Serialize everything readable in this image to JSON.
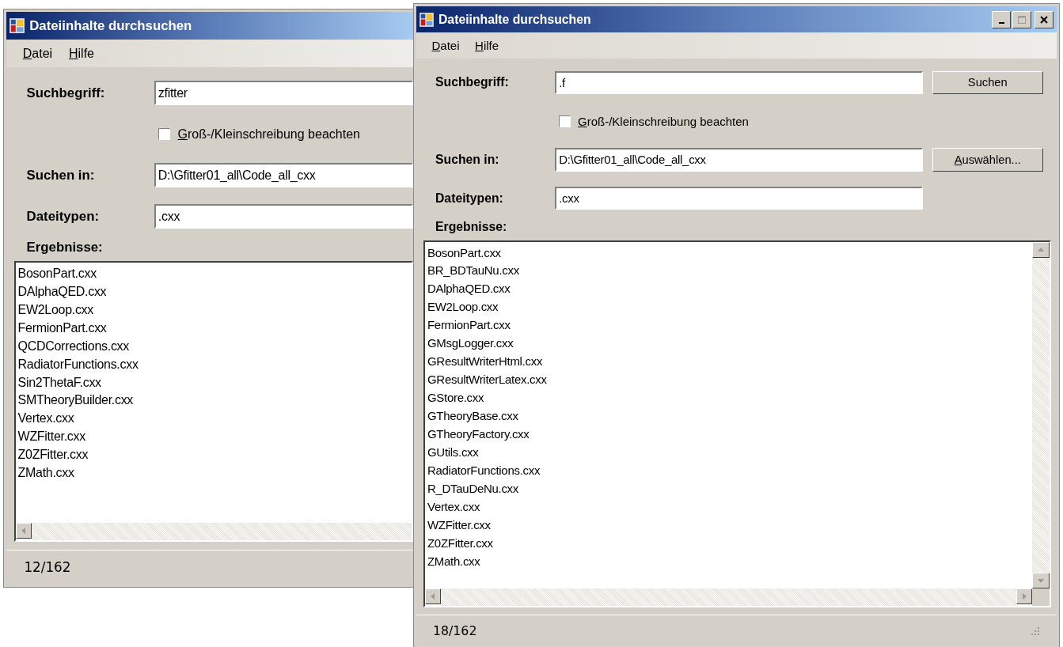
{
  "windows": [
    {
      "title": "Dateiinhalte durchsuchen",
      "covered_right": true,
      "menu": [
        "Datei",
        "Hilfe"
      ],
      "search": {
        "label": "Suchbegriff:",
        "value": "zfitter"
      },
      "case_sensitive": {
        "label": "Groß-/Kleinschreibung beachten",
        "checked": false
      },
      "folder": {
        "label": "Suchen in:",
        "value": "D:\\Gfitter01_all\\Code_all_cxx"
      },
      "types": {
        "label": "Dateitypen:",
        "value": ".cxx"
      },
      "results_label": "Ergebnisse:",
      "results": [
        "BosonPart.cxx",
        "DAlphaQED.cxx",
        "EW2Loop.cxx",
        "FermionPart.cxx",
        "QCDCorrections.cxx",
        "RadiatorFunctions.cxx",
        "Sin2ThetaF.cxx",
        "SMTheoryBuilder.cxx",
        "Vertex.cxx",
        "WZFitter.cxx",
        "Z0ZFitter.cxx",
        "ZMath.cxx"
      ],
      "status": "12/162"
    },
    {
      "title": "Dateiinhalte durchsuchen",
      "covered_right": false,
      "menu": [
        "Datei",
        "Hilfe"
      ],
      "search": {
        "label": "Suchbegriff:",
        "value": ".f",
        "button": "Suchen"
      },
      "case_sensitive": {
        "label": "Groß-/Kleinschreibung beachten",
        "checked": false
      },
      "folder": {
        "label": "Suchen in:",
        "value": "D:\\Gfitter01_all\\Code_all_cxx",
        "button": "Auswählen..."
      },
      "types": {
        "label": "Dateitypen:",
        "value": ".cxx"
      },
      "results_label": "Ergebnisse:",
      "results": [
        "BosonPart.cxx",
        "BR_BDTauNu.cxx",
        "DAlphaQED.cxx",
        "EW2Loop.cxx",
        "FermionPart.cxx",
        "GMsgLogger.cxx",
        "GResultWriterHtml.cxx",
        "GResultWriterLatex.cxx",
        "GStore.cxx",
        "GTheoryBase.cxx",
        "GTheoryFactory.cxx",
        "GUtils.cxx",
        "RadiatorFunctions.cxx",
        "R_DTauDeNu.cxx",
        "Vertex.cxx",
        "WZFitter.cxx",
        "Z0ZFitter.cxx",
        "ZMath.cxx"
      ],
      "status": "18/162"
    }
  ]
}
